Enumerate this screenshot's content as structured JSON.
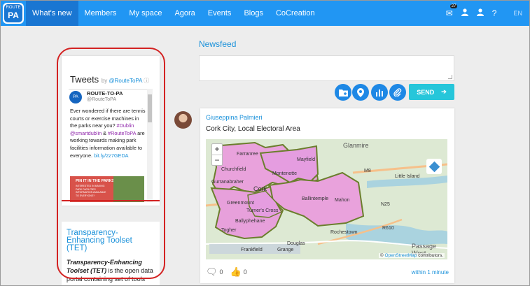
{
  "nav": {
    "logo_top": "ROUTE",
    "logo_text": "PA",
    "items": [
      "What's new",
      "Members",
      "My space",
      "Agora",
      "Events",
      "Blogs",
      "CoCreation"
    ],
    "active_index": 0,
    "messages_badge": "27",
    "language": "EN",
    "icons": [
      "envelope-icon",
      "user-icon",
      "user-icon",
      "help-icon"
    ]
  },
  "tweets": {
    "title": "Tweets",
    "by": "by",
    "handle": "@RouteToPA",
    "account_name": "ROUTE-TO-PA",
    "account_handle": "@RouteToPA",
    "avatar_text": "PA",
    "tweet_text_1": "Ever wondered if there are tennis courts or exercise machines in the parks near you? ",
    "tweet_hashtag_1": "#Dublin",
    "tweet_mention_1": " @smartdublin",
    "tweet_text_2": " & ",
    "tweet_hashtag_2": "#RouteToPA",
    "tweet_text_3": " are working towards making park facilities information available to everyone. ",
    "tweet_link": "bit.ly/2z7GEDA",
    "image_title": "PIN IT IN THE PARKS",
    "image_text": "INTERESTED IN MAKING PARK FACILITIES INFORMATION AVAILABLE TO EVERYONE?"
  },
  "tet": {
    "title": "Transparency-Enhancing Toolset (TET)",
    "desc_bold": "Transparency-Enhancing Toolset (TET)",
    "desc_rest": " is the open data portal containing set of tools"
  },
  "newsfeed": {
    "title": "Newsfeed",
    "send_label": "SEND",
    "actions": [
      "add-folder-icon",
      "location-pin-icon",
      "bar-chart-icon",
      "attachment-icon"
    ]
  },
  "post": {
    "author": "Giuseppina Palmieri",
    "area": "Cork City, Local Electoral Area",
    "comments": "0",
    "likes": "0",
    "time": "within 1 minute",
    "map": {
      "zoom_in": "+",
      "zoom_out": "−",
      "attribution_prefix": "© ",
      "attribution_link": "OpenStreetMap",
      "attribution_suffix": " contributors.",
      "labels": {
        "glanmire": "Glanmire",
        "mayfield": "Mayfield",
        "montenotte": "Montenotte",
        "churchfield": "Churchfield",
        "farranree": "Farranree",
        "cork": "Cork",
        "gurranabraher": "Gurranabraher",
        "ballintemple": "Ballintemple",
        "mahon": "Mahon",
        "greenmount": "Greenmount",
        "turners_cross": "Turner's Cross",
        "ballyphehane": "Ballyphehane",
        "togher": "Togher",
        "douglas": "Douglas",
        "rochestown": "Rochestown",
        "little_island": "Little Island",
        "passage_west": "Passage West",
        "grange": "Grange",
        "frankfield": "Frankfield",
        "m8": "M8",
        "n25": "N25",
        "r610": "R610"
      }
    }
  }
}
